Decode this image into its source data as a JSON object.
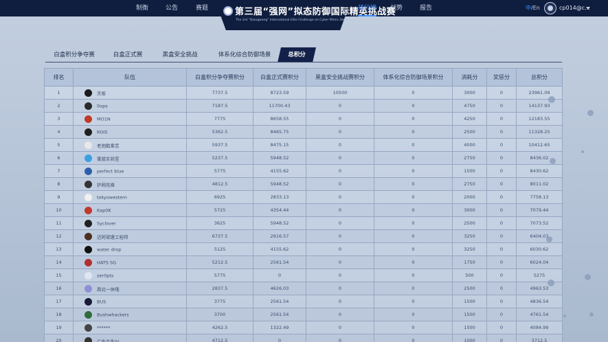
{
  "nav": {
    "left": [
      "制衡",
      "公告",
      "赛题"
    ],
    "right": [
      "排行榜",
      "战势",
      "报告"
    ]
  },
  "logo": {
    "title": "第三届“强网”拟态防御国际精英挑战赛",
    "subtitle": "The 3rd \"Qiangwang\" International Elite Challenge on Cyber Mimic Defense"
  },
  "lang": {
    "zh": "中",
    "sep": "/",
    "en": "En"
  },
  "user": {
    "name": "cp014@c..."
  },
  "tabs": [
    "白盒积分争夺赛",
    "白盒正式赛",
    "黑盒安全挑战",
    "体系化综合防御场景",
    "总积分"
  ],
  "active_tab": "总积分",
  "table": {
    "columns": [
      "排名",
      "队伍",
      "白盒积分争夺赛积分",
      "白盒正式赛积分",
      "黑盒安全挑战赛积分",
      "体系化综合防御场景积分",
      "消耗分",
      "奖惩分",
      "总积分"
    ],
    "rows": [
      {
        "rank": "1",
        "team": "天枢",
        "c1": "7737.5",
        "c2": "8723.59",
        "c3": "10500",
        "c4": "0",
        "c5": "3000",
        "c6": "0",
        "total": "23961.09",
        "logo_color": "#1b1b1b"
      },
      {
        "rank": "2",
        "team": "0ops",
        "c1": "7187.5",
        "c2": "11700.43",
        "c3": "0",
        "c4": "0",
        "c5": "4750",
        "c6": "0",
        "total": "14137.93",
        "logo_color": "#2a2a2a"
      },
      {
        "rank": "3",
        "team": "MO1N",
        "c1": "7775",
        "c2": "8658.55",
        "c3": "0",
        "c4": "0",
        "c5": "4250",
        "c6": "0",
        "total": "12183.55",
        "logo_color": "#c0392b"
      },
      {
        "rank": "4",
        "team": "ROIS",
        "c1": "5362.5",
        "c2": "8465.75",
        "c3": "0",
        "c4": "0",
        "c5": "2500",
        "c6": "0",
        "total": "11328.25",
        "logo_color": "#1f1f1f"
      },
      {
        "rank": "5",
        "team": "老炮酷乘竞",
        "c1": "5937.5",
        "c2": "8475.15",
        "c3": "0",
        "c4": "0",
        "c5": "4000",
        "c6": "0",
        "total": "10412.65",
        "logo_color": "#e8e8e8"
      },
      {
        "rank": "6",
        "team": "蜜拔实验室",
        "c1": "5237.5",
        "c2": "5948.52",
        "c3": "0",
        "c4": "0",
        "c5": "2750",
        "c6": "0",
        "total": "8436.02",
        "logo_color": "#3aa0e0"
      },
      {
        "rank": "7",
        "team": "perfect blue",
        "c1": "5775",
        "c2": "4155.62",
        "c3": "0",
        "c4": "0",
        "c5": "1500",
        "c6": "0",
        "total": "8430.62",
        "logo_color": "#2d5fa8"
      },
      {
        "rank": "8",
        "team": "护网先锋",
        "c1": "4812.5",
        "c2": "5948.52",
        "c3": "0",
        "c4": "0",
        "c5": "2750",
        "c6": "0",
        "total": "8011.02",
        "logo_color": "#333333"
      },
      {
        "rank": "9",
        "team": "tokyowestern",
        "c1": "6925",
        "c2": "2833.13",
        "c3": "0",
        "c4": "0",
        "c5": "2000",
        "c6": "0",
        "total": "7758.13",
        "logo_color": "#f0f0f0"
      },
      {
        "rank": "10",
        "team": "Kap0K",
        "c1": "5725",
        "c2": "4354.44",
        "c3": "0",
        "c4": "0",
        "c5": "3000",
        "c6": "0",
        "total": "7079.44",
        "logo_color": "#c0392b"
      },
      {
        "rank": "11",
        "team": "Syclover",
        "c1": "3625",
        "c2": "5948.52",
        "c3": "0",
        "c4": "0",
        "c5": "2500",
        "c6": "0",
        "total": "7073.52",
        "logo_color": "#222222"
      },
      {
        "rank": "12",
        "team": "迈阿密塘工程师",
        "c1": "6737.5",
        "c2": "2916.57",
        "c3": "0",
        "c4": "0",
        "c5": "3250",
        "c6": "0",
        "total": "6404.07",
        "logo_color": "#4a3020"
      },
      {
        "rank": "13",
        "team": "water drop",
        "c1": "5125",
        "c2": "4155.62",
        "c3": "0",
        "c4": "0",
        "c5": "3250",
        "c6": "0",
        "total": "6030.62",
        "logo_color": "#111111"
      },
      {
        "rank": "14",
        "team": "HATS SG",
        "c1": "5212.5",
        "c2": "2561.54",
        "c3": "0",
        "c4": "0",
        "c5": "1750",
        "c6": "0",
        "total": "6024.04",
        "logo_color": "#b03030"
      },
      {
        "rank": "15",
        "team": "zer0pts",
        "c1": "5775",
        "c2": "0",
        "c3": "0",
        "c4": "0",
        "c5": "500",
        "c6": "0",
        "total": "5275",
        "logo_color": "#dfe6f2"
      },
      {
        "rank": "16",
        "team": "西北一休哦",
        "c1": "2837.5",
        "c2": "4626.03",
        "c3": "0",
        "c4": "0",
        "c5": "2500",
        "c6": "0",
        "total": "4963.53",
        "logo_color": "#8f8fd8"
      },
      {
        "rank": "17",
        "team": "BUS",
        "c1": "3775",
        "c2": "2561.54",
        "c3": "0",
        "c4": "0",
        "c5": "1500",
        "c6": "0",
        "total": "4836.54",
        "logo_color": "#1a1a3a"
      },
      {
        "rank": "18",
        "team": "Bushwhackers",
        "c1": "3700",
        "c2": "2561.54",
        "c3": "0",
        "c4": "0",
        "c5": "1500",
        "c6": "0",
        "total": "4761.54",
        "logo_color": "#2f6d3c"
      },
      {
        "rank": "19",
        "team": "******",
        "c1": "4262.5",
        "c2": "1322.49",
        "c3": "0",
        "c4": "0",
        "c5": "1500",
        "c6": "0",
        "total": "4084.99",
        "logo_color": "#444444"
      },
      {
        "rank": "20",
        "team": "广外女生IV",
        "c1": "4712.5",
        "c2": "0",
        "c3": "0",
        "c4": "0",
        "c5": "1000",
        "c6": "0",
        "total": "3712.5",
        "logo_color": "#333333"
      }
    ]
  },
  "colors": {
    "nav_bg": "#0f1d3e",
    "accent": "#3f8cff",
    "tab_active_bg": "#13214a",
    "page_bg": "#bdcadc"
  }
}
